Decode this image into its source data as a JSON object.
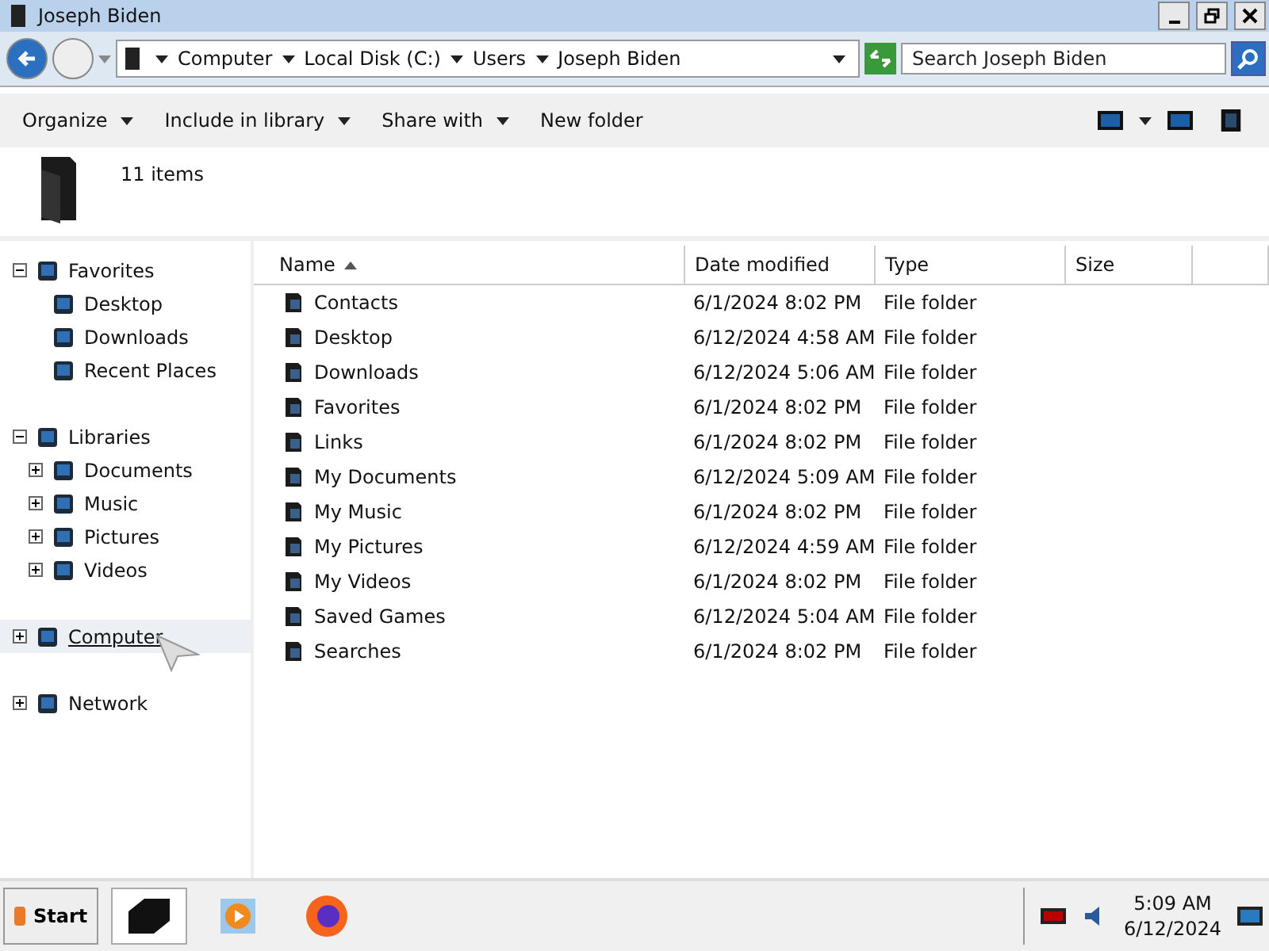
{
  "window": {
    "title": "Joseph Biden"
  },
  "address": {
    "crumbs": [
      "Computer",
      "Local Disk (C:)",
      "Users",
      "Joseph Biden"
    ]
  },
  "search": {
    "placeholder": "Search Joseph Biden"
  },
  "toolbar": {
    "items": [
      {
        "label": "Organize",
        "dropdown": true
      },
      {
        "label": "Include in library",
        "dropdown": true
      },
      {
        "label": "Share with",
        "dropdown": true
      },
      {
        "label": "New folder",
        "dropdown": false
      }
    ]
  },
  "details": {
    "count": "11 items"
  },
  "sidebar": {
    "items": [
      {
        "label": "Favorites",
        "expanded": true,
        "hovered": false,
        "children": [
          {
            "label": "Desktop",
            "hovered": false
          },
          {
            "label": "Downloads",
            "hovered": false
          },
          {
            "label": "Recent Places",
            "hovered": false
          }
        ]
      },
      {
        "label": "Libraries",
        "expanded": true,
        "hovered": false,
        "children": [
          {
            "label": "Documents",
            "expanded": false,
            "hovered": false
          },
          {
            "label": "Music",
            "expanded": false,
            "hovered": false
          },
          {
            "label": "Pictures",
            "expanded": false,
            "hovered": false
          },
          {
            "label": "Videos",
            "expanded": false,
            "hovered": false
          }
        ]
      },
      {
        "label": "Computer",
        "expanded": false,
        "hovered": true
      },
      {
        "label": "Network",
        "expanded": false,
        "hovered": false
      }
    ]
  },
  "table": {
    "columns": [
      {
        "label": "Name",
        "sorted": true
      },
      {
        "label": "Date modified",
        "sorted": false
      },
      {
        "label": "Type",
        "sorted": false
      },
      {
        "label": "Size",
        "sorted": false
      }
    ],
    "rows": [
      {
        "name": "Contacts",
        "date": "6/1/2024 8:02 PM",
        "type": "File folder"
      },
      {
        "name": "Desktop",
        "date": "6/12/2024 4:58 AM",
        "type": "File folder"
      },
      {
        "name": "Downloads",
        "date": "6/12/2024 5:06 AM",
        "type": "File folder"
      },
      {
        "name": "Favorites",
        "date": "6/1/2024 8:02 PM",
        "type": "File folder"
      },
      {
        "name": "Links",
        "date": "6/1/2024 8:02 PM",
        "type": "File folder"
      },
      {
        "name": "My Documents",
        "date": "6/12/2024 5:09 AM",
        "type": "File folder"
      },
      {
        "name": "My Music",
        "date": "6/1/2024 8:02 PM",
        "type": "File folder"
      },
      {
        "name": "My Pictures",
        "date": "6/12/2024 4:59 AM",
        "type": "File folder"
      },
      {
        "name": "My Videos",
        "date": "6/1/2024 8:02 PM",
        "type": "File folder"
      },
      {
        "name": "Saved Games",
        "date": "6/12/2024 5:04 AM",
        "type": "File folder"
      },
      {
        "name": "Searches",
        "date": "6/1/2024 8:02 PM",
        "type": "File folder"
      }
    ]
  },
  "taskbar": {
    "start": "Start",
    "apps": [
      {
        "kind": "explorer",
        "selected": true
      },
      {
        "kind": "media",
        "selected": false
      },
      {
        "kind": "browser",
        "selected": false
      }
    ],
    "time": "5:09 AM",
    "date": "6/12/2024"
  }
}
